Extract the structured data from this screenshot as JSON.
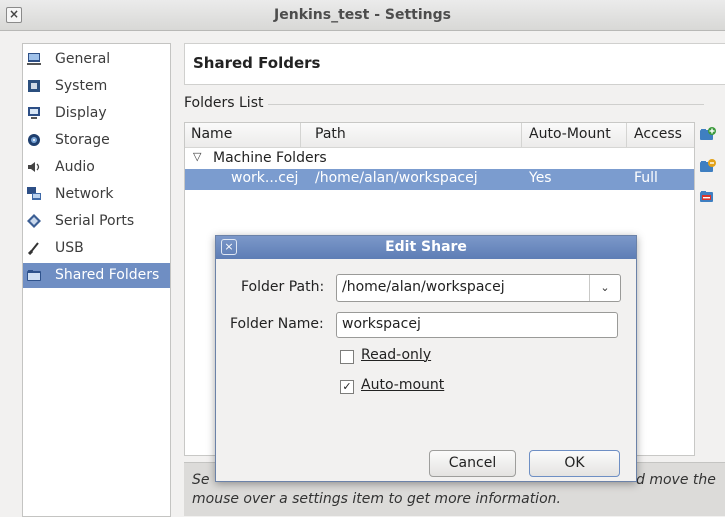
{
  "window": {
    "title": "Jenkins_test - Settings",
    "close_glyph": "×"
  },
  "sidebar": {
    "items": [
      {
        "label": "General",
        "icon": "general-icon",
        "selected": false
      },
      {
        "label": "System",
        "icon": "system-icon",
        "selected": false
      },
      {
        "label": "Display",
        "icon": "display-icon",
        "selected": false
      },
      {
        "label": "Storage",
        "icon": "storage-icon",
        "selected": false
      },
      {
        "label": "Audio",
        "icon": "audio-icon",
        "selected": false
      },
      {
        "label": "Network",
        "icon": "network-icon",
        "selected": false
      },
      {
        "label": "Serial Ports",
        "icon": "serial-ports-icon",
        "selected": false
      },
      {
        "label": "USB",
        "icon": "usb-icon",
        "selected": false
      },
      {
        "label": "Shared Folders",
        "icon": "shared-folders-icon",
        "selected": true
      }
    ]
  },
  "page": {
    "title": "Shared Folders",
    "group_label": "Folders List"
  },
  "table": {
    "columns": [
      "Name",
      "Path",
      "Auto-Mount",
      "Access"
    ],
    "group": {
      "expander": "▽",
      "label": "Machine Folders"
    },
    "rows": [
      {
        "name": "work...cej",
        "path": "/home/alan/workspacej",
        "auto_mount": "Yes",
        "access": "Full"
      }
    ]
  },
  "footer": {
    "line1_left": "Se",
    "line1_right": "d move the",
    "line2": "mouse over a settings item to get more information."
  },
  "dialog": {
    "title": "Edit Share",
    "close_glyph": "×",
    "folder_path_label": "Folder Path:",
    "folder_path_value": "/home/alan/workspacej",
    "combo_arrow": "⌄",
    "folder_name_label": "Folder Name:",
    "folder_name_value": "workspacej",
    "read_only_label": "Read-only",
    "read_only_checked": false,
    "auto_mount_label": "Auto-mount",
    "auto_mount_checked": true,
    "check_mark": "✓",
    "cancel_label": "Cancel",
    "ok_label": "OK"
  },
  "colors": {
    "selection": "#7b9ccf",
    "sidebar_selection": "#6f8ec3",
    "dialog_title": "#5d7db5",
    "add_icon": "#3c9a3c",
    "folder_icon": "#3f7fc1"
  }
}
